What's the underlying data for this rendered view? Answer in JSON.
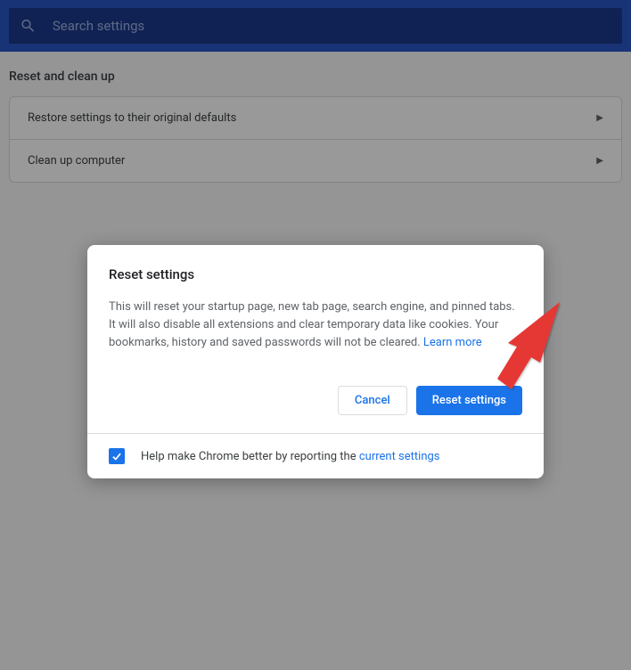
{
  "search": {
    "placeholder": "Search settings"
  },
  "section": {
    "title": "Reset and clean up",
    "rows": [
      {
        "label": "Restore settings to their original defaults"
      },
      {
        "label": "Clean up computer"
      }
    ]
  },
  "dialog": {
    "title": "Reset settings",
    "body_text": "This will reset your startup page, new tab page, search engine, and pinned tabs. It will also disable all extensions and clear temporary data like cookies. Your bookmarks, history and saved passwords will not be cleared. ",
    "learn_more": "Learn more",
    "cancel_label": "Cancel",
    "confirm_label": "Reset settings",
    "footer_text_prefix": "Help make Chrome better by reporting the ",
    "footer_link": "current settings",
    "checkbox_checked": true
  }
}
